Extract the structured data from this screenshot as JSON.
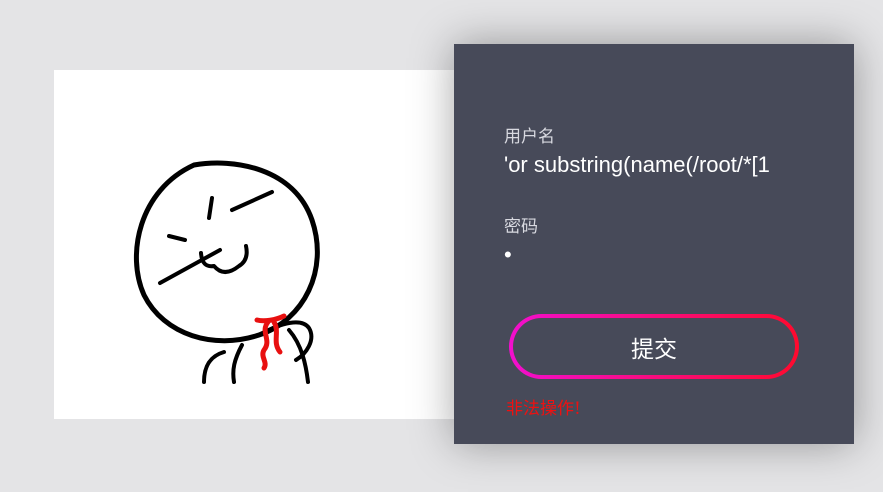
{
  "login": {
    "username_label": "用户名",
    "username_value": "'or substring(name(/root/*[1",
    "password_label": "密码",
    "password_value": "•",
    "submit_label": "提交",
    "error_message": "非法操作!"
  },
  "illustration": {
    "icon": "smug-face-icon"
  },
  "colors": {
    "background": "#e4e4e6",
    "panel": "#474a59",
    "button_gradient_start": "#f20fce",
    "button_gradient_end": "#ff0a2e",
    "error": "#ee1111",
    "scarf": "#e81010"
  }
}
